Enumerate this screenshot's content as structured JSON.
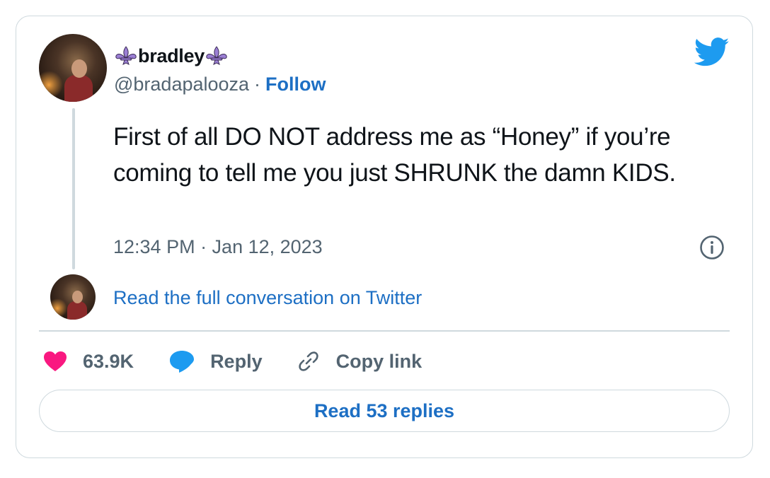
{
  "author": {
    "display_name": "bradley",
    "handle": "@bradapalooza",
    "separator": "·",
    "follow_label": "Follow"
  },
  "tweet": {
    "text": "First of all DO NOT address me as “Honey” if you’re coming to tell me you just SHRUNK the damn KIDS.",
    "timestamp": "12:34 PM · Jan 12, 2023"
  },
  "conversation_link": "Read the full conversation on Twitter",
  "actions": {
    "likes": "63.9K",
    "reply_label": "Reply",
    "copy_link_label": "Copy link"
  },
  "read_replies_label": "Read 53 replies",
  "icons": {
    "brand": "twitter-bird-icon",
    "name_decoration": "fleur-de-lis-icon",
    "info": "info-icon",
    "like": "heart-icon",
    "reply": "speech-bubble-icon",
    "copy": "link-icon"
  },
  "colors": {
    "link": "#1d6fc4",
    "heart": "#f91880",
    "reply": "#1d9bf0",
    "brand": "#1d9bf0",
    "fleur": "#9b7fd4",
    "muted": "#536471",
    "text": "#0f1419"
  }
}
